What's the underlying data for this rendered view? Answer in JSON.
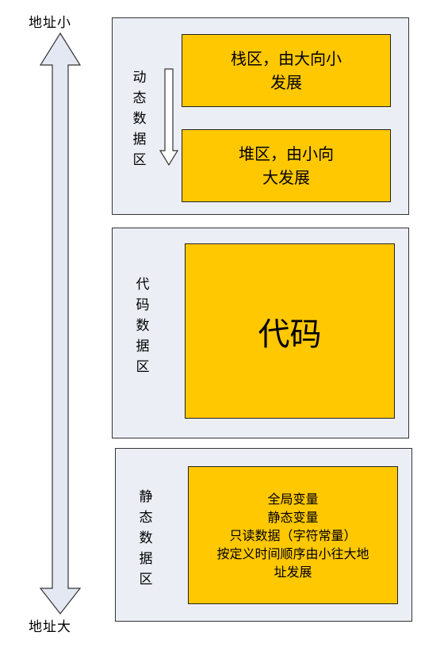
{
  "address": {
    "top_label": "地址小",
    "bottom_label": "地址大"
  },
  "colors": {
    "region_bg": "#eceef6",
    "box_fill": "#ffc800",
    "arrow_fill": "#e4e8f2"
  },
  "regions": {
    "dynamic": {
      "label_chars": [
        "动",
        "态",
        "数",
        "据",
        "区"
      ],
      "stack_text": "栈区，由大向小\n发展",
      "heap_text": "堆区，由小向\n大发展"
    },
    "code": {
      "label_chars": [
        "代",
        "码",
        "数",
        "据",
        "区"
      ],
      "box_text": "代码"
    },
    "static": {
      "label_chars": [
        "静",
        "态",
        "数",
        "据",
        "区"
      ],
      "box_text": "全局变量\n静态变量\n只读数据（字符常量）\n按定义时间顺序由小往大地\n址发展"
    }
  }
}
